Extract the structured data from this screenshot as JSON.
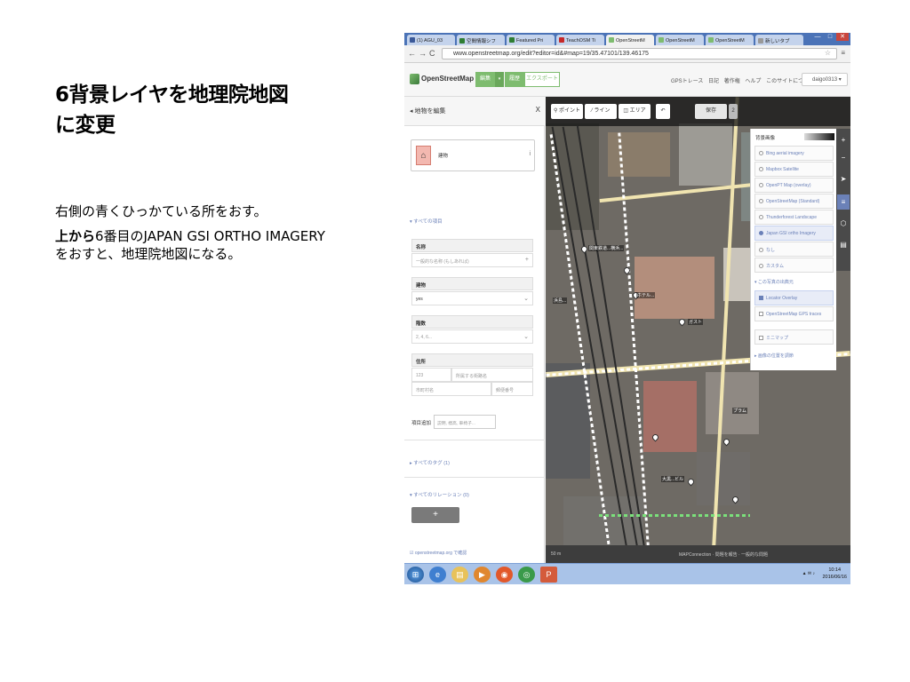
{
  "slide": {
    "title_line1": "6背景レイヤを地理院地図",
    "title_line2": "に変更",
    "body_line1": "右側の青くひっかている所をおす。",
    "body_line2_bold": "上から",
    "body_line2_rest": "6番目のJAPAN GSI ORTHO IMAGERY　をおすと、地理院地図にな",
    "body_line3": "る。"
  },
  "browser": {
    "tabs": [
      {
        "label": "(1) AGU_03",
        "color": "#3b5998"
      },
      {
        "label": "空間情報シフ",
        "color": "#2e7d32"
      },
      {
        "label": "Featured Pri",
        "color": "#2e7d32"
      },
      {
        "label": "TeachOSM Ti",
        "color": "#c62828"
      },
      {
        "label": "OpenStreetM",
        "color": "#7ebc6f"
      },
      {
        "label": "OpenStreetM",
        "color": "#7ebc6f"
      },
      {
        "label": "OpenStreetM",
        "color": "#7ebc6f"
      },
      {
        "label": "新しいタブ",
        "color": "#999999"
      }
    ],
    "url": "www.openstreetmap.org/edit?editor=id&#map=19/35.47101/139.46175",
    "win_min": "—",
    "win_max": "□",
    "win_close": "✕"
  },
  "osm": {
    "brand": "OpenStreetMap",
    "edit": "編集",
    "history": "履歴",
    "export": "エクスポート",
    "header_links": [
      "GPSトレース",
      "日記",
      "著作権",
      "ヘルプ",
      "このサイトについて"
    ],
    "user": "daigo0313"
  },
  "sidebar": {
    "title": "地物を編集",
    "close": "X",
    "preset": "建物",
    "all_fields": "▾ すべての項目",
    "fields": [
      {
        "label": "名称",
        "value": "一般的な名称 (もしあれば)",
        "suffix": "+"
      },
      {
        "label": "建物",
        "value": "yes",
        "suffix": "⌄"
      },
      {
        "label": "階数",
        "value": "2, 4, 6...",
        "suffix": "⌄"
      },
      {
        "label": "住所",
        "value": "123",
        "value2": "所属する街路名",
        "value3": "市町村名",
        "value4": "郵便番号"
      }
    ],
    "add_field_label": "項目追加",
    "add_field_placeholder": "説明, 標高, 車椅子...",
    "all_tags": "▸ すべてのタグ (1)",
    "all_relations": "▾ すべてのリレーション (0)",
    "plus": "+",
    "footer": "openstreetmap.org で確認"
  },
  "map": {
    "toolbar": {
      "point": "ポイント",
      "line": "ライン",
      "area": "エリア",
      "undo": "↶",
      "save": "保存",
      "count": "2"
    },
    "labels": [
      "関東鉄道...横浜...",
      "浜島...",
      "ホテル...",
      "ガスト",
      "プラム",
      "大黒...ビル"
    ],
    "background_panel": {
      "title": "背景画像",
      "items": [
        {
          "label": "Bing aerial imagery",
          "selected": false
        },
        {
          "label": "Mapbox Satellite",
          "selected": false
        },
        {
          "label": "OpenPT Map (overlay)",
          "selected": false
        },
        {
          "label": "OpenStreetMap (Standard)",
          "selected": false
        },
        {
          "label": "Thunderforest Landscape",
          "selected": false
        },
        {
          "label": "Japan GSI ortho Imagery",
          "selected": true
        },
        {
          "label": "なし",
          "selected": false
        },
        {
          "label": "カスタム",
          "selected": false
        }
      ],
      "overlays_link": "▾ この写真の出典元",
      "overlays": [
        {
          "label": "Locator Overlay",
          "checked": true
        },
        {
          "label": "OpenStreetMap GPS traces",
          "checked": false
        }
      ],
      "minimap": "ミニマップ",
      "align_link": "▸ 画像の位置を調節"
    },
    "controls": [
      "+",
      "−",
      "➤",
      "≡",
      "⬡",
      "▤"
    ],
    "status_left": "50 m",
    "status_right": "MAPConnection · 問題を報告 · 一般的な問題"
  },
  "taskbar": {
    "clock_time": "10:14",
    "clock_date": "2016/06/16"
  }
}
